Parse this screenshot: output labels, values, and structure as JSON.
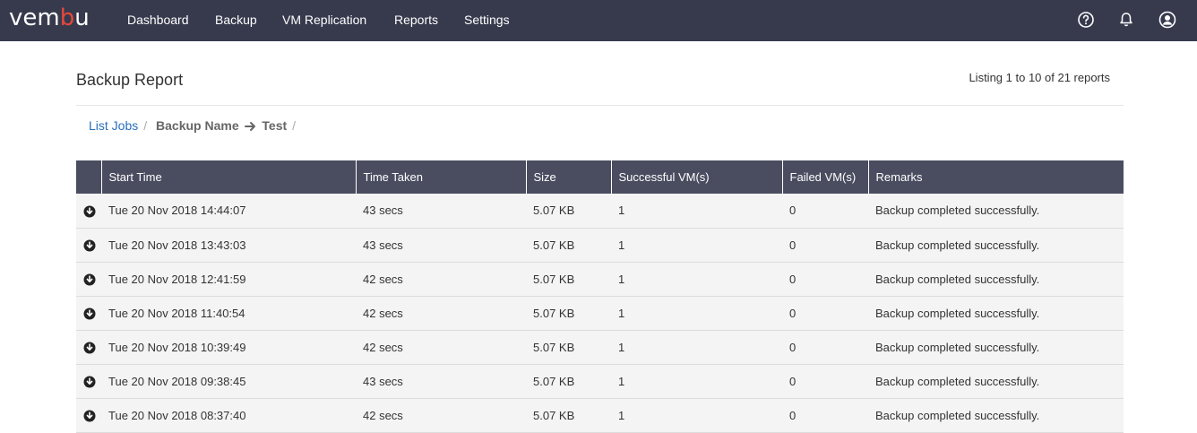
{
  "brand": {
    "logo_pre": "vem",
    "logo_accent": "b",
    "logo_post": "u",
    "nav_bg": "#373a4d",
    "accent": "#e8473b"
  },
  "nav": {
    "items": [
      {
        "label": "Dashboard"
      },
      {
        "label": "Backup"
      },
      {
        "label": "VM Replication"
      },
      {
        "label": "Reports"
      },
      {
        "label": "Settings"
      }
    ],
    "right_icons": [
      "help-icon",
      "bell-icon",
      "user-icon"
    ]
  },
  "page": {
    "title": "Backup Report",
    "listing": "Listing 1 to 10 of 21 reports"
  },
  "breadcrumb": {
    "link": "List Jobs",
    "sep": "/",
    "current_label": "Backup Name",
    "current_value": "Test",
    "trailing_sep": "/"
  },
  "table": {
    "headers": [
      "Start Time",
      "Time Taken",
      "Size",
      "Successful VM(s)",
      "Failed VM(s)",
      "Remarks"
    ],
    "rows": [
      [
        "Tue 20 Nov 2018 14:44:07",
        "43 secs",
        "5.07 KB",
        "1",
        "0",
        "Backup completed successfully."
      ],
      [
        "Tue 20 Nov 2018 13:43:03",
        "43 secs",
        "5.07 KB",
        "1",
        "0",
        "Backup completed successfully."
      ],
      [
        "Tue 20 Nov 2018 12:41:59",
        "42 secs",
        "5.07 KB",
        "1",
        "0",
        "Backup completed successfully."
      ],
      [
        "Tue 20 Nov 2018 11:40:54",
        "42 secs",
        "5.07 KB",
        "1",
        "0",
        "Backup completed successfully."
      ],
      [
        "Tue 20 Nov 2018 10:39:49",
        "42 secs",
        "5.07 KB",
        "1",
        "0",
        "Backup completed successfully."
      ],
      [
        "Tue 20 Nov 2018 09:38:45",
        "43 secs",
        "5.07 KB",
        "1",
        "0",
        "Backup completed successfully."
      ],
      [
        "Tue 20 Nov 2018 08:37:40",
        "42 secs",
        "5.07 KB",
        "1",
        "0",
        "Backup completed successfully."
      ]
    ]
  }
}
